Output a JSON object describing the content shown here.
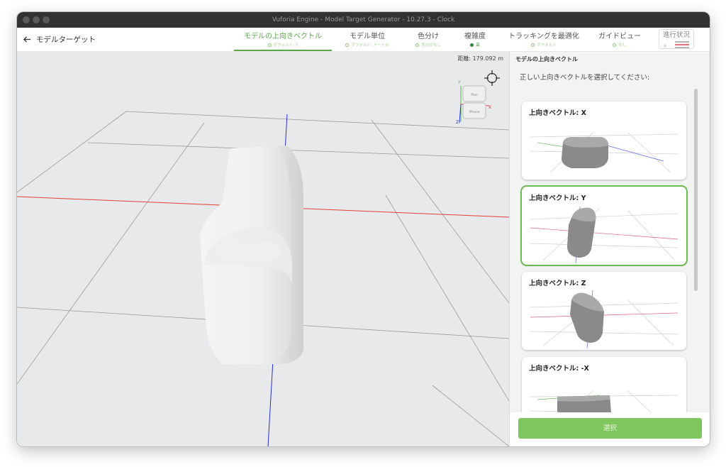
{
  "window": {
    "title": "Vuforia Engine - Model Target Generator - 10.27.3 - Clock"
  },
  "nav": {
    "back_label": "モデルターゲット",
    "steps": [
      {
        "label": "モデルの上向きベクトル",
        "sub": "デフォルト: Y"
      },
      {
        "label": "モデル単位",
        "sub": "デフォルト: メートル"
      },
      {
        "label": "色分け",
        "sub": "色分けなし"
      },
      {
        "label": "複雑度",
        "sub": "高"
      },
      {
        "label": "トラッキングを最適化",
        "sub": "デフォルト"
      },
      {
        "label": "ガイドビュー",
        "sub": "なし"
      }
    ],
    "progress_label": "進行状況",
    "progress_mini": "高",
    "colors": {
      "accent": "#5aa84a",
      "progress_gray": "#b5b5b5",
      "progress_red": "#e0707a"
    }
  },
  "viewport": {
    "distance": "距離: 179.092 m",
    "gizmo": {
      "top_label": "Plan",
      "front_label": "iPhone",
      "x": "X",
      "y": "Y",
      "z": "Z"
    }
  },
  "panel": {
    "title": "モデルの上向きベクトル",
    "instruction": "正しい上向きベクトルを選択してください:",
    "options": [
      {
        "label": "上向きベクトル: X",
        "selected": false
      },
      {
        "label": "上向きベクトル: Y",
        "selected": true
      },
      {
        "label": "上向きベクトル: Z",
        "selected": false
      },
      {
        "label": "上向きベクトル: -X",
        "selected": false
      }
    ],
    "select_button": "選択"
  }
}
